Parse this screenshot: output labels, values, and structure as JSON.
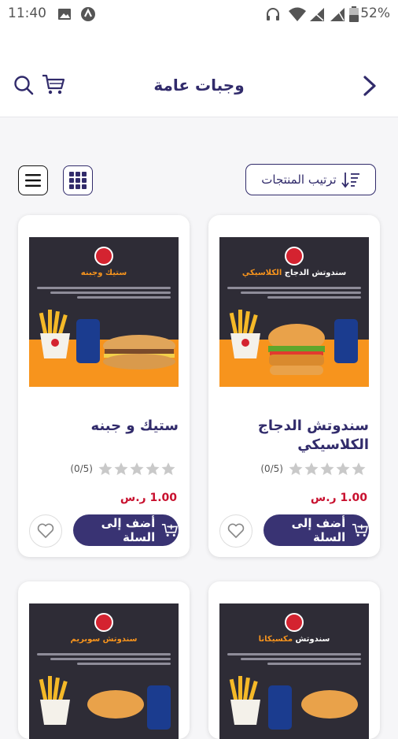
{
  "status_bar": {
    "time": "11:40",
    "battery_pct": "52%"
  },
  "app_bar": {
    "title": "وجبات عامة"
  },
  "toolbar": {
    "sort_label": "ترتيب المنتجات"
  },
  "products": [
    {
      "name": "سندوتش الدجاج الكلاسيكي",
      "rating_text": "(0/5)",
      "stars_filled": 0,
      "price": "1.00 ر.س",
      "add_label": "أضف إلى السلة",
      "image": {
        "banner_prefix": "سندوتش الدجاج ",
        "banner_highlight": "الكلاسيكي",
        "item": "chicken-burger"
      }
    },
    {
      "name": "ستيك و جبنه",
      "rating_text": "(0/5)",
      "stars_filled": 0,
      "price": "1.00 ر.س",
      "add_label": "أضف إلى السلة",
      "image": {
        "banner_prefix": "",
        "banner_highlight": "ستيك وجبنه",
        "item": "steak-sub"
      }
    },
    {
      "image": {
        "banner_prefix": "سندوتش ",
        "banner_highlight": "مكسيكانا",
        "item": "chicken-burger"
      }
    },
    {
      "image": {
        "banner_prefix": "",
        "banner_highlight": "سندوتش سوبريم",
        "item": "beef-burger"
      }
    }
  ],
  "colors": {
    "primary": "#393373",
    "title": "#312b6b",
    "price": "#c8102e",
    "accent_orange": "#f7941d"
  }
}
